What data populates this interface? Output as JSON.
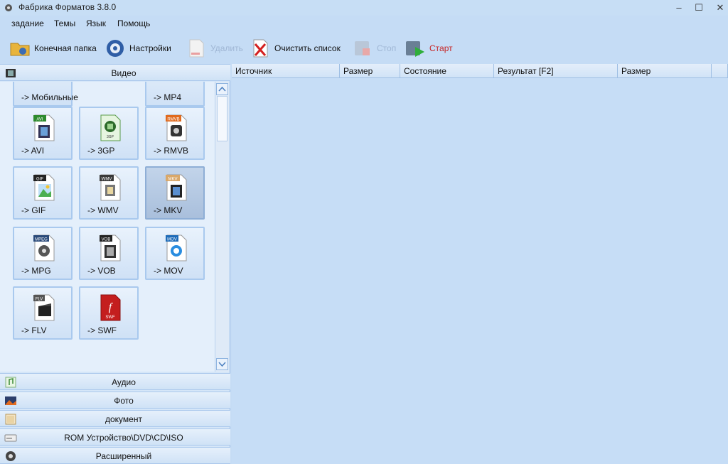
{
  "window": {
    "title": "Фабрика Форматов 3.8.0",
    "controls": [
      "–",
      "☐",
      "✕"
    ]
  },
  "menu": [
    "задание",
    "Темы",
    "Язык",
    "Помощь"
  ],
  "toolbar": {
    "output_folder": "Конечная папка",
    "settings": "Настройки",
    "delete": "Удалить",
    "clear_list": "Очистить список",
    "stop": "Стоп",
    "start": "Старт"
  },
  "categories": {
    "video": "Видео",
    "audio": "Аудио",
    "photo": "Фото",
    "document": "документ",
    "rom": "ROM Устройство\\DVD\\CD\\ISO",
    "advanced": "Расширенный"
  },
  "formats": [
    {
      "label": "-> Мобильные",
      "badge": ""
    },
    {
      "label": "-> MP4",
      "badge": ""
    },
    {
      "label": "-> AVI",
      "badge": "AVI"
    },
    {
      "label": "-> 3GP",
      "badge": "3GP"
    },
    {
      "label": "-> RMVB",
      "badge": "RMVB"
    },
    {
      "label": "-> GIF",
      "badge": "GIF"
    },
    {
      "label": "-> WMV",
      "badge": "WMV"
    },
    {
      "label": "-> MKV",
      "badge": "MKV",
      "selected": true
    },
    {
      "label": "-> MPG",
      "badge": "MPEG"
    },
    {
      "label": "-> VOB",
      "badge": "VOB"
    },
    {
      "label": "-> MOV",
      "badge": "MOV"
    },
    {
      "label": "-> FLV",
      "badge": "FLV"
    },
    {
      "label": "-> SWF",
      "badge": "SWF"
    }
  ],
  "table": {
    "columns": [
      "Источник",
      "Размер",
      "Состояние",
      "Результат [F2]",
      "Размер"
    ]
  },
  "colors": {
    "accent": "#c62828",
    "panel": "#d5e6f8",
    "border": "#a9c9ee"
  }
}
